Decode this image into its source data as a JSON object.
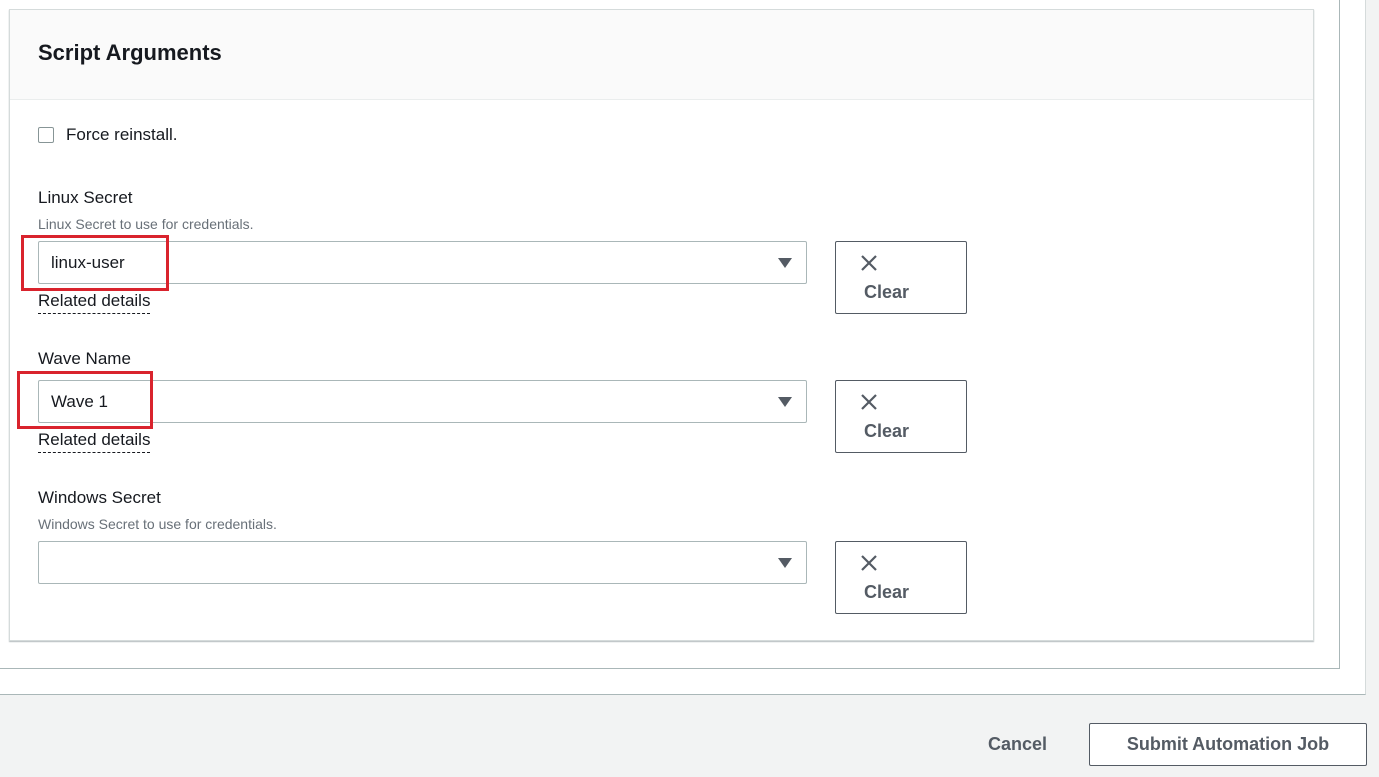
{
  "panel": {
    "title": "Script Arguments"
  },
  "force_reinstall": {
    "label": "Force reinstall.",
    "checked": false
  },
  "linux_secret": {
    "label": "Linux Secret",
    "description": "Linux Secret to use for credentials.",
    "value": "linux-user",
    "related": "Related details",
    "clear": "Clear"
  },
  "wave_name": {
    "label": "Wave Name",
    "value": "Wave 1",
    "related": "Related details",
    "clear": "Clear"
  },
  "windows_secret": {
    "label": "Windows Secret",
    "description": "Windows Secret to use for credentials.",
    "value": "",
    "clear": "Clear"
  },
  "footer": {
    "cancel": "Cancel",
    "submit": "Submit Automation Job"
  },
  "colors": {
    "highlight": "#d9232d",
    "background": "#f2f3f3",
    "button_text": "#545b64"
  }
}
